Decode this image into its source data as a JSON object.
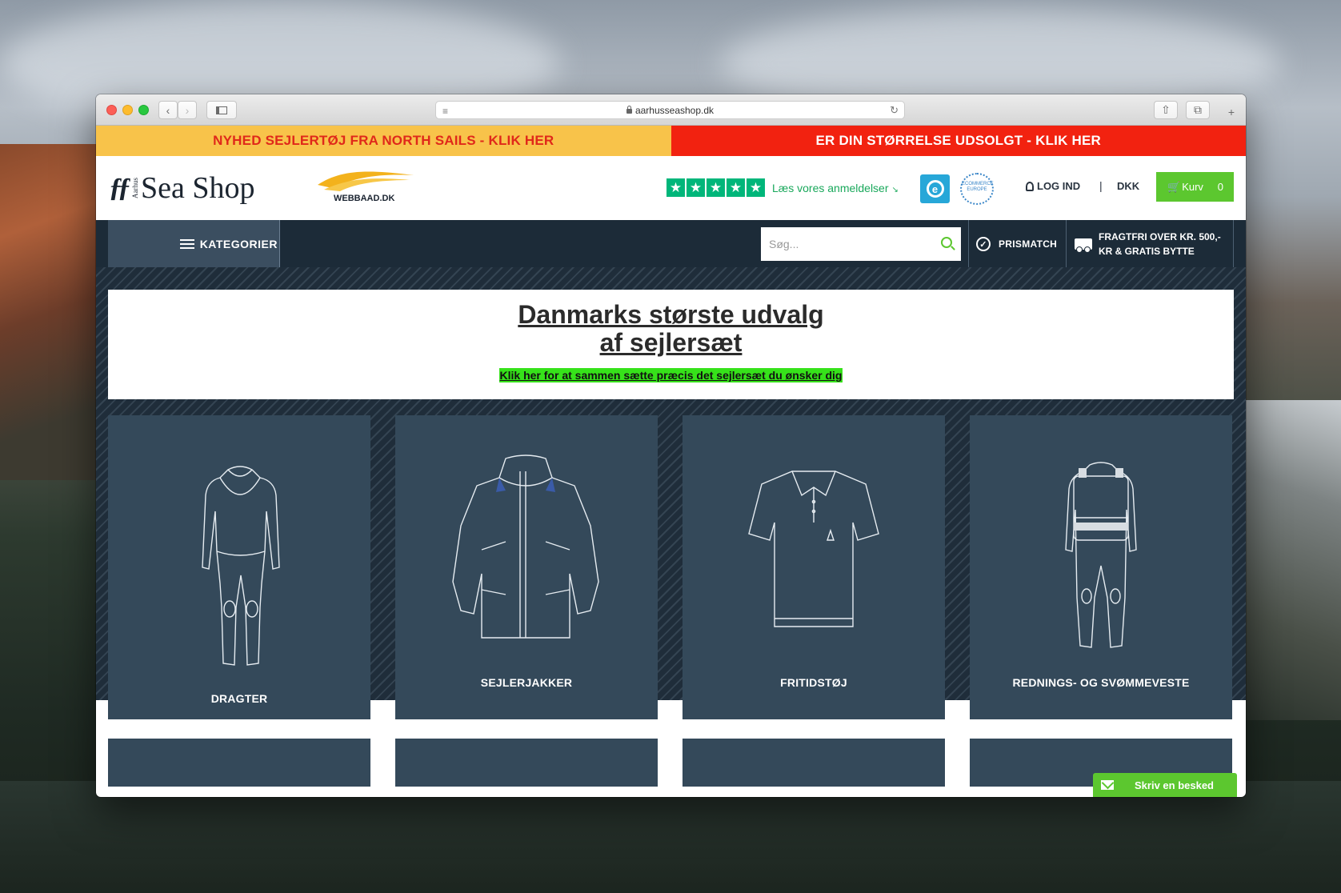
{
  "browser": {
    "url": "aarhusseashop.dk"
  },
  "promo": {
    "left": "NYHED SEJLERTØJ FRA NORTH SAILS - KLIK HER",
    "right": "ER DIN STØRRELSE UDSOLGT - KLIK HER"
  },
  "header": {
    "logo_small": "Aarhus",
    "logo_name": "Sea Shop",
    "partner": "WEBBAAD.DK",
    "reviews_label": "Læs vores anmeldelser",
    "reviews_stars": 5,
    "eu_badge": "ECOMMERCE EUROPE",
    "login": "LOG IND",
    "separator": "|",
    "currency": "DKK",
    "cart_label": "Kurv",
    "cart_count": "0"
  },
  "nav": {
    "categories": "KATEGORIER",
    "search_placeholder": "Søg...",
    "prismatch": "PRISMATCH",
    "shipping_line1": "FRAGTFRI OVER KR. 500,-",
    "shipping_line2": "KR & GRATIS BYTTE"
  },
  "hero": {
    "title_line1": "Danmarks største udvalg",
    "title_line2": "af sejlersæt",
    "cta": "Klik her for at sammen sætte præcis det sejlersæt du ønsker dig"
  },
  "tiles": [
    {
      "label": "DRAGTER",
      "icon": "wetsuit-icon"
    },
    {
      "label": "SEJLERJAKKER",
      "icon": "jacket-icon"
    },
    {
      "label": "FRITIDSTØJ",
      "icon": "polo-shirt-icon"
    },
    {
      "label": "REDNINGS- OG SVØMMEVESTE",
      "icon": "life-vest-icon"
    }
  ],
  "chat": {
    "label": "Skriv en besked"
  },
  "colors": {
    "promo_left_bg": "#f8c34a",
    "promo_left_text": "#e0281a",
    "promo_right_bg": "#f22210",
    "nav_bg": "#1c2b38",
    "tile_bg": "#34495a",
    "accent_green": "#5cc72f",
    "trustpilot_green": "#00b67a"
  }
}
